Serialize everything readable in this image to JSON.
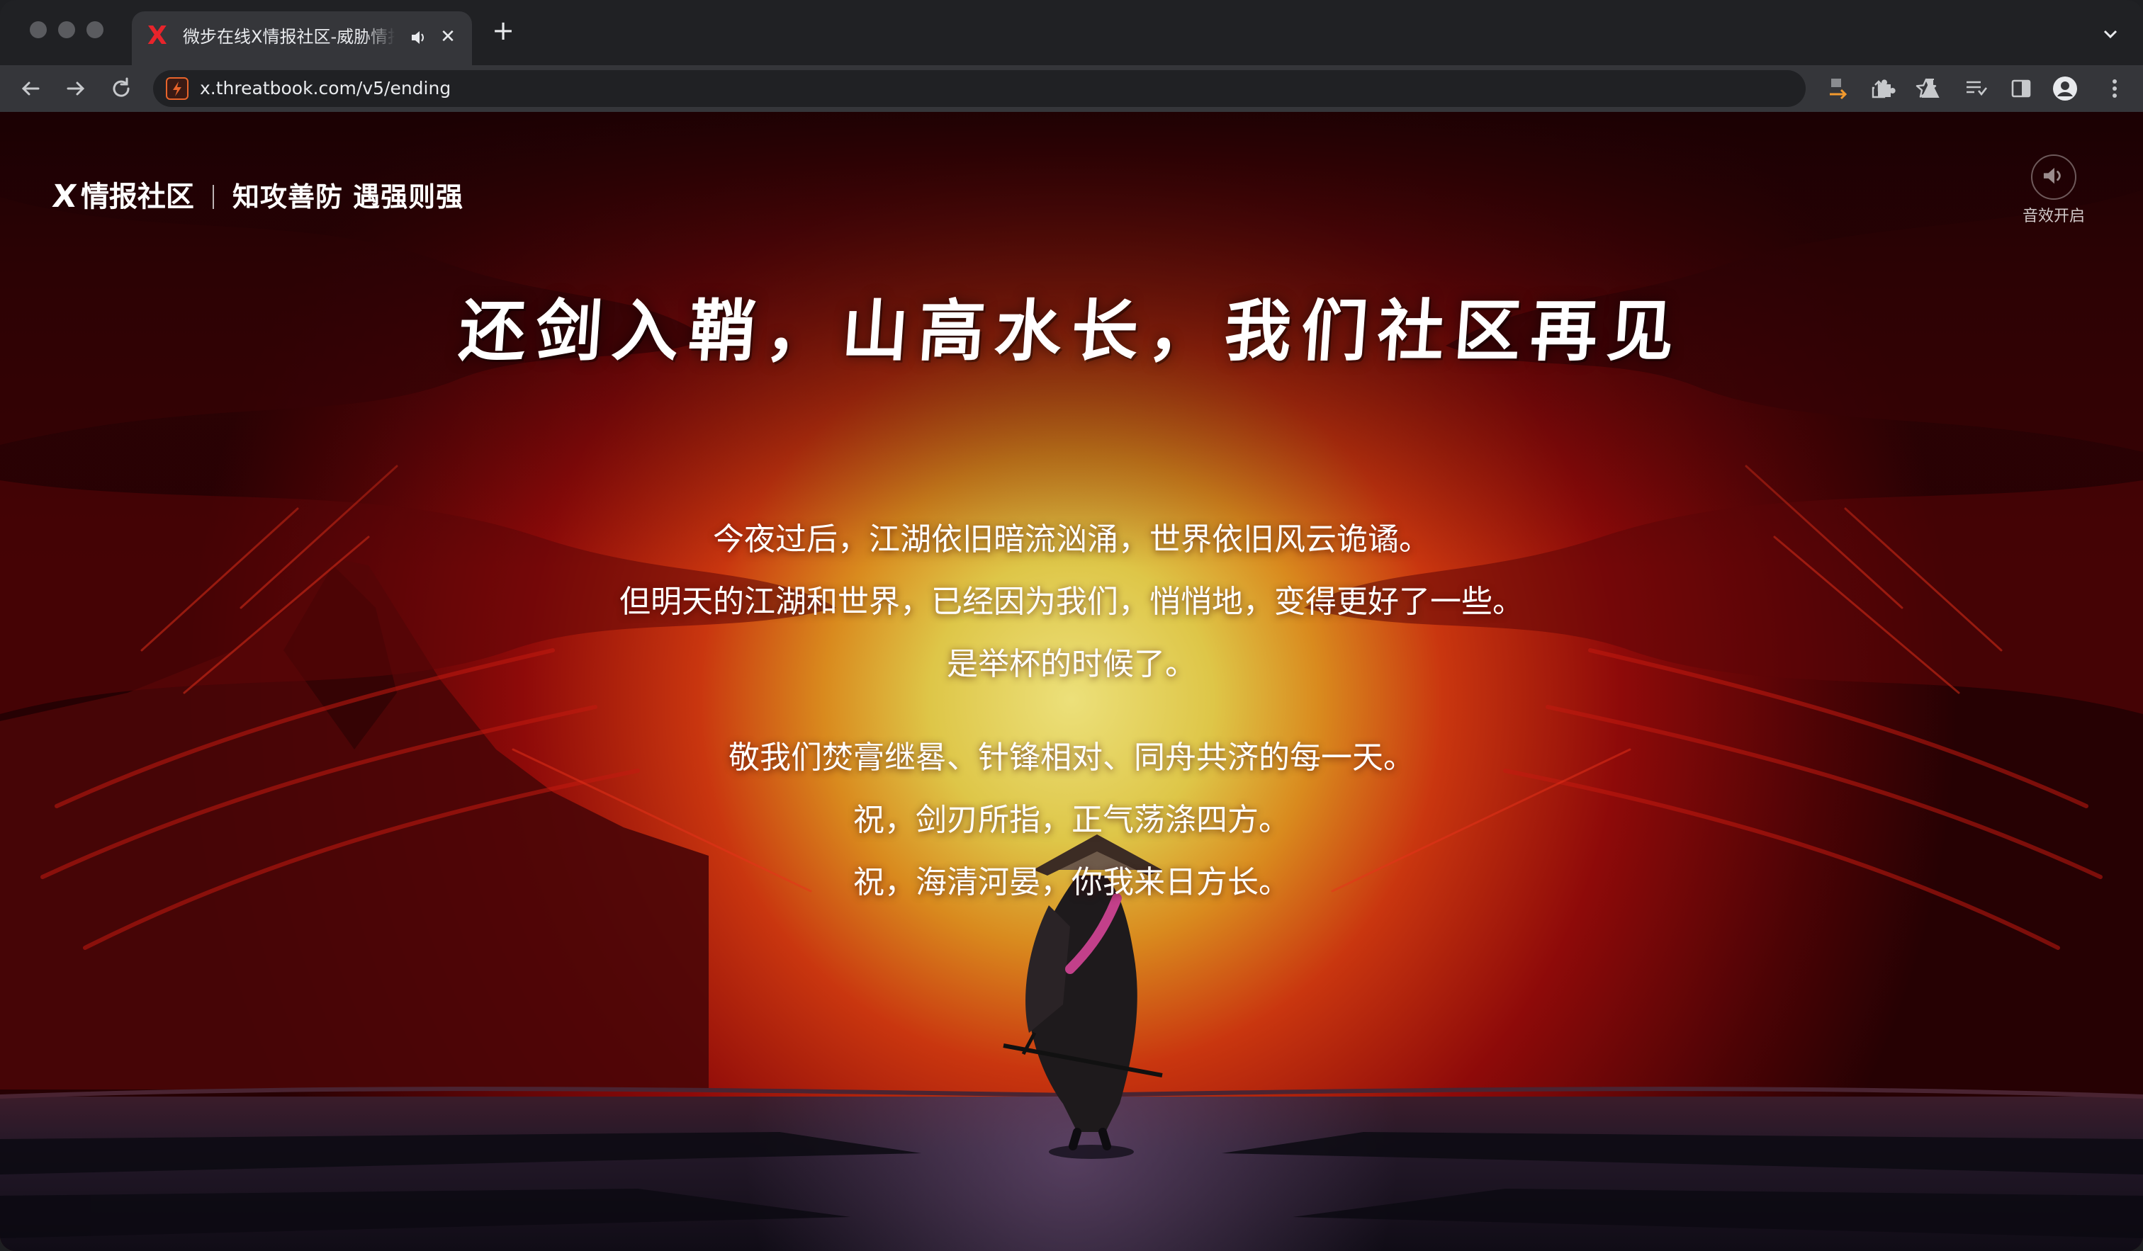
{
  "browser": {
    "tab": {
      "title": "微步在线X情报社区-威胁情报",
      "favicon": "X"
    },
    "url": "x.threatbook.com/v5/ending"
  },
  "page": {
    "brand": {
      "logo_mark": "X",
      "name": "情报社区",
      "slogan": "知攻善防 遇强则强"
    },
    "sound": {
      "label": "音效开启",
      "icon": "speaker-icon"
    },
    "headline": "还剑入鞘，山高水长，我们社区再见",
    "paragraph_1": [
      "今夜过后，江湖依旧暗流汹涌，世界依旧风云诡谲。",
      "但明天的江湖和世界，已经因为我们，悄悄地，变得更好了一些。",
      "是举杯的时候了。"
    ],
    "paragraph_2": [
      "敬我们焚膏继晷、针锋相对、同舟共济的每一天。",
      "祝，剑刃所指，正气荡涤四方。",
      "祝，海清河晏，你我来日方长。"
    ]
  },
  "colors": {
    "sky_red": "#9e0d0b",
    "sun_glow": "#e8d255",
    "dark_ground": "#1b1624",
    "accent_brand": "#e8242b"
  }
}
